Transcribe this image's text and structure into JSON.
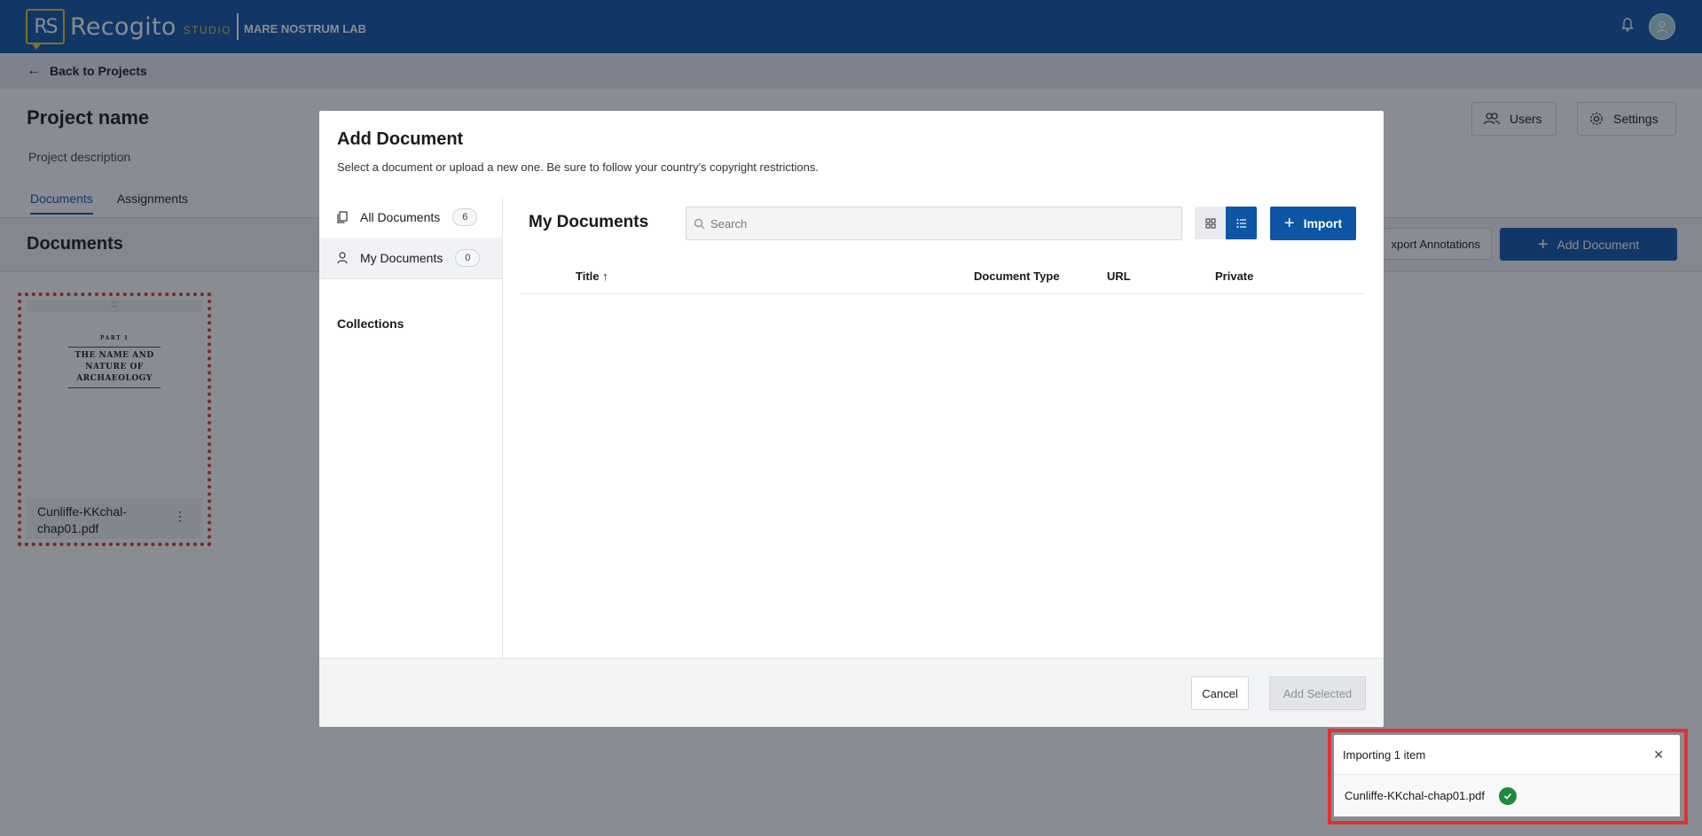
{
  "topbar": {
    "logo_mark": "RS",
    "brand": "Recogito",
    "brand_suffix": "STUDIO",
    "org": "MARE NOSTRUM LAB",
    "bell_icon": "bell-icon",
    "avatar_icon": "user-icon"
  },
  "nav": {
    "back_label": "Back to Projects"
  },
  "project": {
    "name": "Project name",
    "description": "Project description",
    "users_label": "Users",
    "settings_label": "Settings",
    "tabs": [
      "Documents",
      "Assignments"
    ],
    "active_tab": "Documents"
  },
  "documents_bar": {
    "title": "Documents",
    "export_label": "xport Annotations",
    "add_label": "Add Document"
  },
  "document_card": {
    "filename_line1": "Cunliffe-KKchal-",
    "filename_line2": "chap01.pdf",
    "thumb_part": "PART I",
    "thumb_title_1": "THE NAME AND",
    "thumb_title_2": "NATURE OF",
    "thumb_title_3": "ARCHAEOLOGY"
  },
  "modal": {
    "title": "Add Document",
    "subtitle": "Select a document or upload a new one. Be sure to follow your country's copyright restrictions.",
    "sidebar": [
      {
        "label": "All Documents",
        "count": "6",
        "icon": "documents-icon"
      },
      {
        "label": "My Documents",
        "count": "0",
        "icon": "user-icon"
      }
    ],
    "collections_label": "Collections",
    "main_title": "My Documents",
    "search_placeholder": "Search",
    "import_label": "Import",
    "columns": {
      "title": "Title",
      "doc_type": "Document Type",
      "url": "URL",
      "private": "Private"
    },
    "cancel_label": "Cancel",
    "add_selected_label": "Add Selected"
  },
  "toast": {
    "title": "Importing 1 item",
    "file": "Cunliffe-KKchal-chap01.pdf",
    "status_icon": "check-circle-icon"
  },
  "colors": {
    "primary": "#0d55a5",
    "accent": "#f0c420",
    "highlight": "#e03232",
    "success": "#1f8a3a"
  }
}
